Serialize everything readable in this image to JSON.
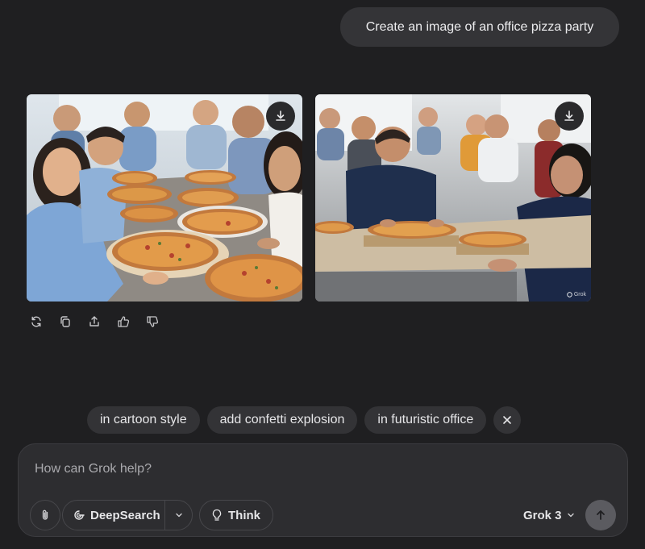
{
  "user_message": "Create an image of an office pizza party",
  "images": [
    {
      "name": "pizza-party-image-1",
      "download_icon": "download-icon"
    },
    {
      "name": "pizza-party-image-2",
      "download_icon": "download-icon",
      "watermark": "Grok"
    }
  ],
  "actions": [
    {
      "icon": "regenerate-icon"
    },
    {
      "icon": "copy-icon"
    },
    {
      "icon": "share-icon"
    },
    {
      "icon": "thumbs-up-icon"
    },
    {
      "icon": "thumbs-down-icon"
    }
  ],
  "suggestions": [
    "in cartoon style",
    "add confetti explosion",
    "in futuristic office"
  ],
  "composer": {
    "placeholder": "How can Grok help?",
    "deepsearch_label": "DeepSearch",
    "think_label": "Think",
    "model_label": "Grok 3"
  },
  "colors": {
    "background": "#1f1f21",
    "bubble": "#343437",
    "chip": "#333336",
    "composer": "#2d2d30"
  }
}
